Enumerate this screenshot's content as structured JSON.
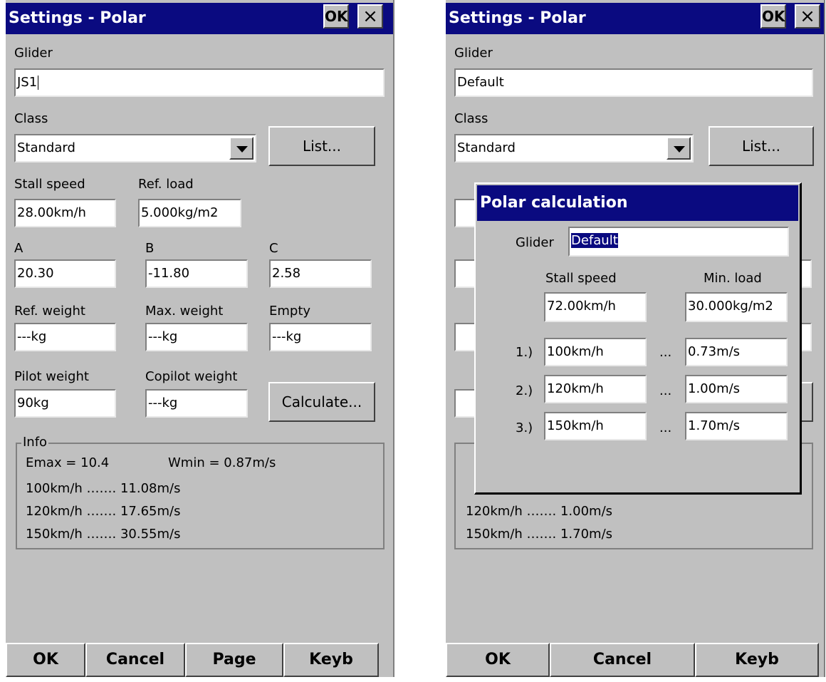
{
  "left": {
    "title": "Settings - Polar",
    "ok_label": "OK",
    "close_label": "×",
    "glider_label": "Glider",
    "glider_value": "JS1",
    "class_label": "Class",
    "class_value": "Standard",
    "list_button": "List...",
    "stall_speed_label": "Stall speed",
    "stall_speed_value": "28.00km/h",
    "ref_load_label": "Ref. load",
    "ref_load_value": "5.000kg/m2",
    "a_label": "A",
    "a_value": "20.30",
    "b_label": "B",
    "b_value": "-11.80",
    "c_label": "C",
    "c_value": "2.58",
    "ref_weight_label": "Ref. weight",
    "ref_weight_value": "---kg",
    "max_weight_label": "Max. weight",
    "max_weight_value": "---kg",
    "empty_label": "Empty",
    "empty_value": "---kg",
    "pilot_weight_label": "Pilot weight",
    "pilot_weight_value": "90kg",
    "copilot_weight_label": "Copilot weight",
    "copilot_weight_value": "---kg",
    "calculate_button": "Calculate...",
    "info_label": "Info",
    "emax": "Emax = 10.4",
    "wmin": "Wmin = 0.87m/s",
    "info_lines": [
      "100km/h ……. 11.08m/s",
      "120km/h ……. 17.65m/s",
      "150km/h ……. 30.55m/s"
    ],
    "bottom": [
      "OK",
      "Cancel",
      "Page",
      "Keyb"
    ]
  },
  "right": {
    "title": "Settings - Polar",
    "ok_label": "OK",
    "close_label": "×",
    "glider_label": "Glider",
    "glider_value": "Default",
    "class_label": "Class",
    "class_value": "Standard",
    "list_button": "List...",
    "info_lines": [
      "120km/h ……. 1.00m/s",
      "150km/h ……. 1.70m/s"
    ],
    "bottom": [
      "OK",
      "Cancel",
      "Keyb"
    ],
    "dialog": {
      "title": "Polar calculation",
      "glider_label": "Glider",
      "glider_value": "Default",
      "stall_speed_label": "Stall speed",
      "stall_speed_value": "72.00km/h",
      "min_load_label": "Min. load",
      "min_load_value": "30.000kg/m2",
      "rows": [
        {
          "index": "1.)",
          "speed": "100km/h",
          "sep": "...",
          "sink": "0.73m/s"
        },
        {
          "index": "2.)",
          "speed": "120km/h",
          "sep": "...",
          "sink": "1.00m/s"
        },
        {
          "index": "3.)",
          "speed": "150km/h",
          "sep": "...",
          "sink": "1.70m/s"
        }
      ]
    }
  }
}
